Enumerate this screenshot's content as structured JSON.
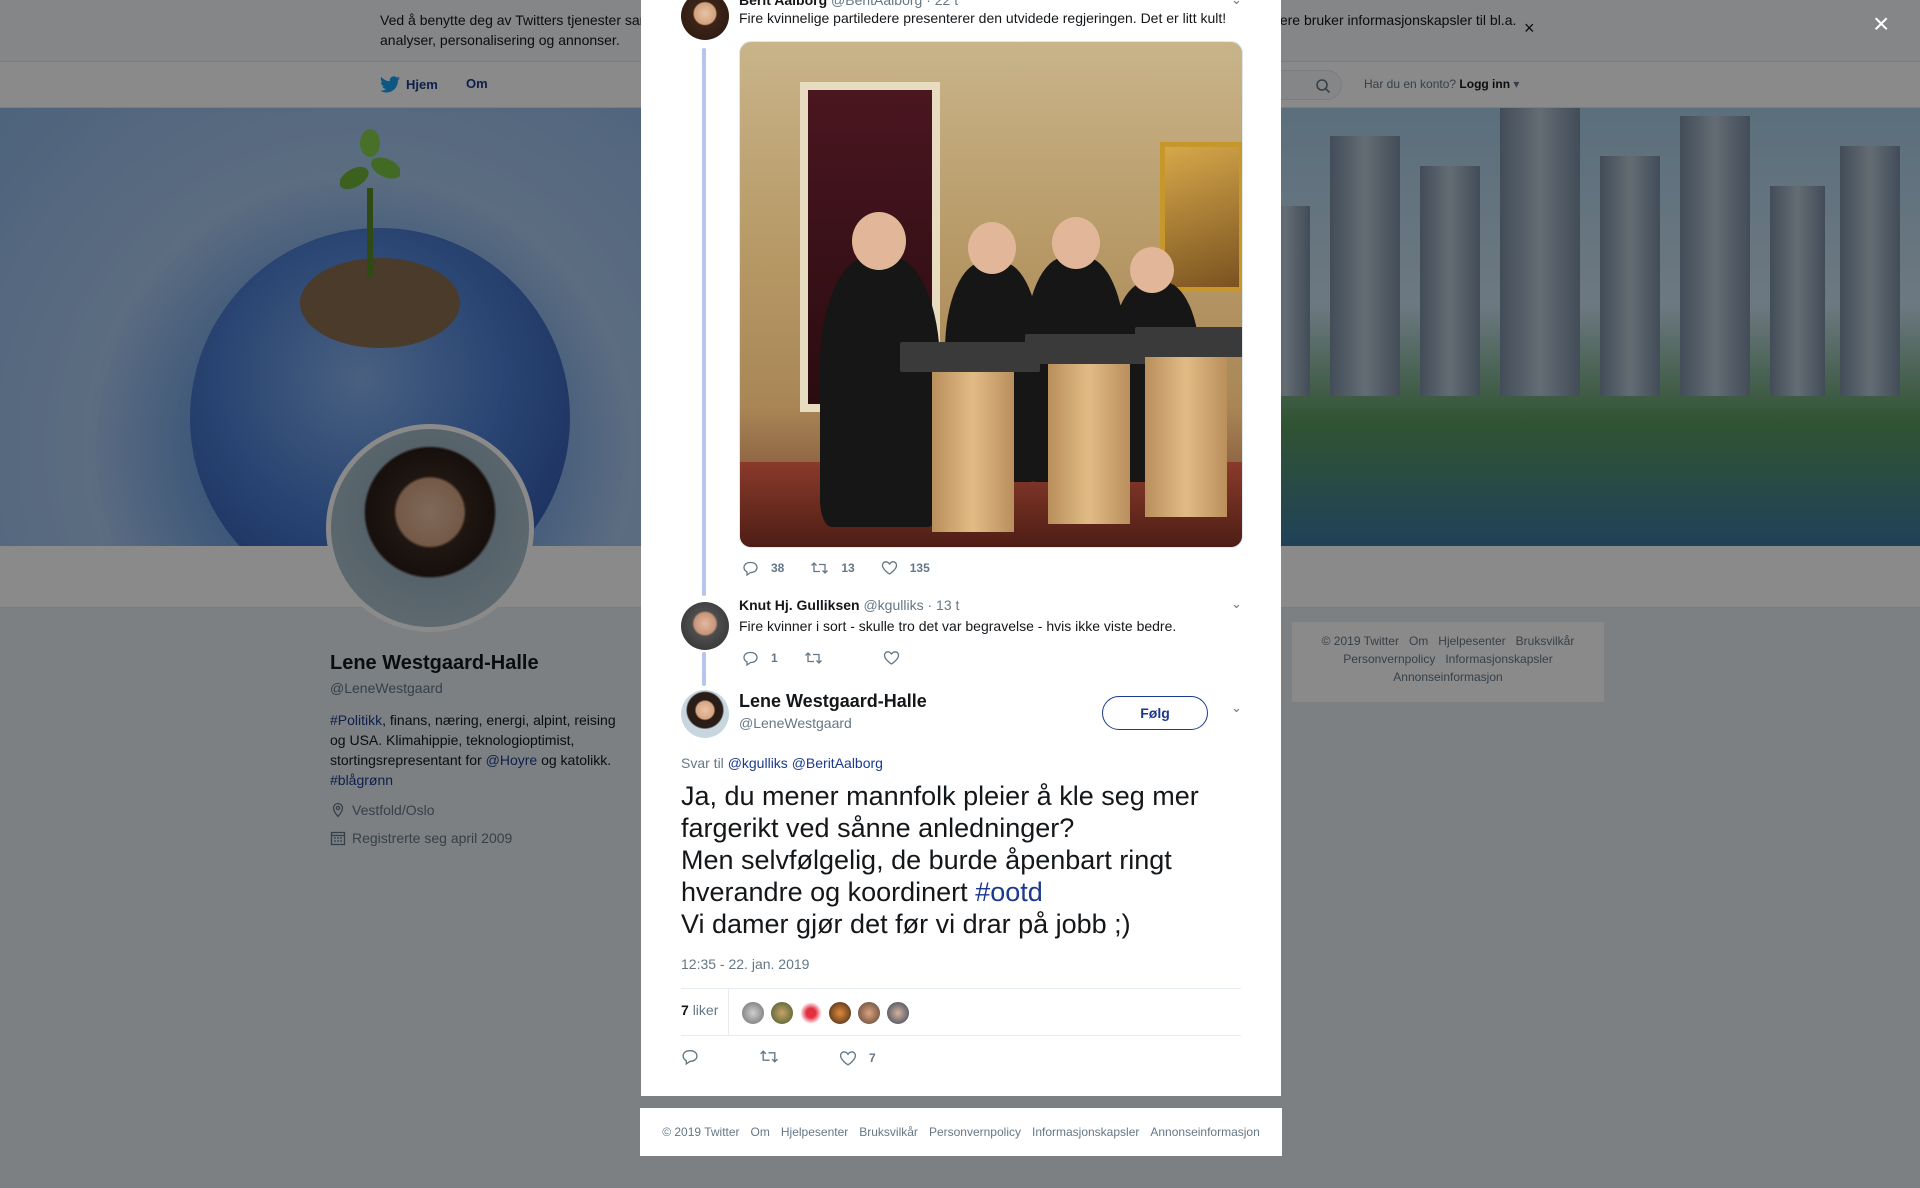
{
  "cookie": {
    "text": "Ved å benytte deg av Twitters tjenester samtykker du i vår bruk av informasjonskapsler og dataoverføring utenfor EU. Vi og våre samarbeidspartnere bruker informasjonskapsler til bl.a. analyser, personalisering og annonser."
  },
  "nav": {
    "home": "Hjem",
    "about": "Om",
    "account_prompt": "Har du en konto?",
    "login": "Logg inn"
  },
  "profile": {
    "name": "Lene Westgaard-Halle",
    "handle": "@LeneWestgaard",
    "bio_hashtag_1": "#Politikk",
    "bio_text_1": ", finans, næring, energi, alpint, reising og USA. Klimahippie, teknologioptimist, stortingsrepresentant for ",
    "bio_mention": "@Hoyre",
    "bio_text_2": " og katolikk. ",
    "bio_hashtag_2": "#blågrønn",
    "location": "Vestfold/Oslo",
    "joined": "Registrerte seg april 2009"
  },
  "side_footer": {
    "copyright": "© 2019 Twitter",
    "about": "Om",
    "help": "Hjelpesenter",
    "terms": "Bruksvilkår",
    "privacy": "Personvernpolicy",
    "cookies": "Informasjonskapsler",
    "ads": "Annonseinformasjon"
  },
  "tweet1": {
    "author": "Berit Aalborg",
    "handle": "@BeritAalborg",
    "time": "· 22 t",
    "text": "Fire kvinnelige partiledere presenterer den utvidede regjeringen. Det er litt kult!",
    "replies": "38",
    "retweets": "13",
    "likes": "135"
  },
  "tweet2": {
    "author": "Knut Hj. Gulliksen",
    "handle": "@kgulliks",
    "time": "· 13 t",
    "text": "Fire kvinner i sort - skulle tro det var begravelse - hvis ikke viste bedre.",
    "replies": "1"
  },
  "main_tweet": {
    "author": "Lene Westgaard-Halle",
    "handle": "@LeneWestgaard",
    "follow": "Følg",
    "reply_prefix": "Svar til",
    "reply_to_1": "@kgulliks",
    "reply_to_2": "@BeritAalborg",
    "line1": "Ja, du mener mannfolk pleier å kle seg mer fargerikt ved sånne anledninger?",
    "line2": "Men selvfølgelig, de burde åpenbart ringt hverandre og koordinert ",
    "hashtag": "#ootd",
    "line3": "Vi damer gjør det før vi drar på jobb ;)",
    "timestamp": "12:35 - 22. jan. 2019",
    "likes_count": "7",
    "likes_label": "liker",
    "likes_action": "7"
  },
  "modal_footer": {
    "copyright": "© 2019 Twitter",
    "about": "Om",
    "help": "Hjelpesenter",
    "terms": "Bruksvilkår",
    "privacy": "Personvernpolicy",
    "cookies": "Informasjonskapsler",
    "ads": "Annonseinformasjon"
  },
  "colors": {
    "link": "#1b3a8c",
    "secondary_text": "#657786",
    "thread_line": "#b6c4ee",
    "overlay": "rgba(0,0,0,0.46)"
  },
  "icons": [
    "twitter-bird-icon",
    "search-icon",
    "close-icon",
    "location-pin-icon",
    "calendar-icon",
    "reply-icon",
    "retweet-icon",
    "heart-icon",
    "chevron-down-icon"
  ]
}
